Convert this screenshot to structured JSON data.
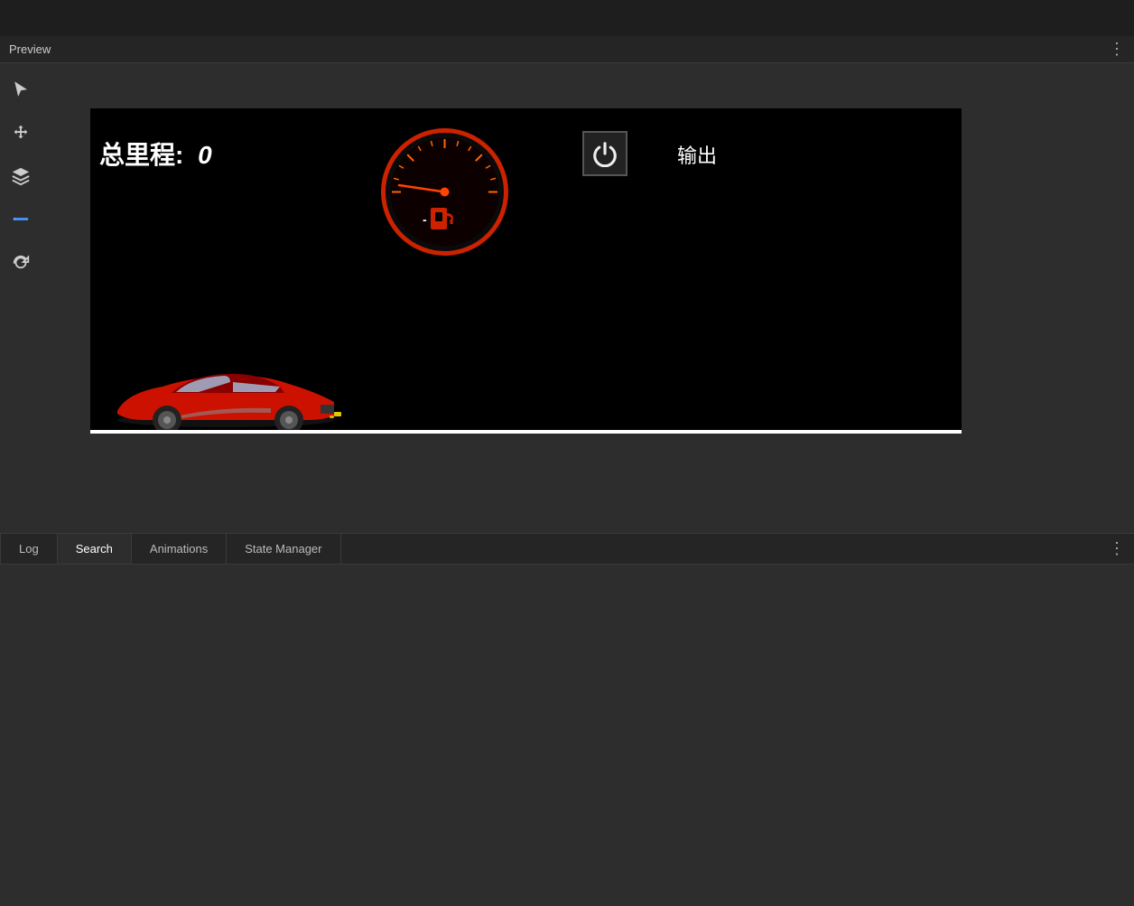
{
  "top_bar": {
    "height": 40
  },
  "preview": {
    "title": "Preview",
    "more_icon": "⋮"
  },
  "toolbar": {
    "cursor_icon": "cursor",
    "move_icon": "move",
    "layers_icon": "layers",
    "text_icon": "text",
    "refresh_icon": "refresh",
    "icons": [
      "cursor",
      "move",
      "layers",
      "text",
      "refresh"
    ]
  },
  "canvas": {
    "odometer_label": "总里程:",
    "odometer_value": "0",
    "output_label": "输出",
    "power_icon": "power"
  },
  "bottom_panel": {
    "tabs": [
      {
        "label": "Log",
        "active": false
      },
      {
        "label": "Search",
        "active": true
      },
      {
        "label": "Animations",
        "active": false
      },
      {
        "label": "State Manager",
        "active": false
      }
    ],
    "more_icon": "⋮"
  }
}
